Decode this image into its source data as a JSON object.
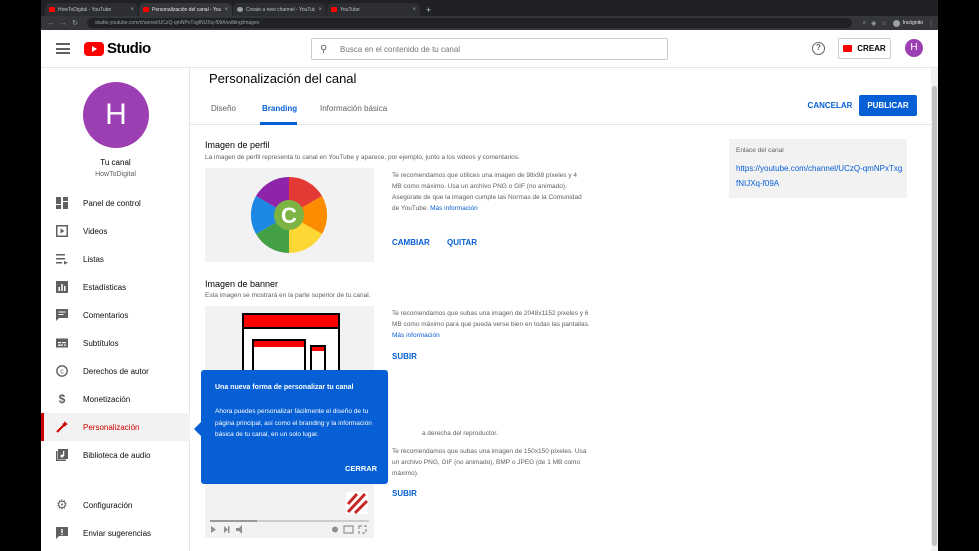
{
  "browser": {
    "tabs": [
      {
        "label": "HowToDigital - YouTube"
      },
      {
        "label": "Personalización del canal - YouTube Studio"
      },
      {
        "label": "Create a new channel - YouTube"
      },
      {
        "label": "YouTube"
      }
    ],
    "new_tab": "+",
    "url": "studio.youtube.com/channel/UCzQ-qmNPxTxgfNIJXq-f09A/editing/images",
    "profile": "Incógnito"
  },
  "header": {
    "logo_text": "Studio",
    "search_placeholder": "Busca en el contenido de tu canal",
    "help": "?",
    "create_label": "CREAR",
    "avatar_letter": "H"
  },
  "sidebar": {
    "avatar_letter": "H",
    "channel_label": "Tu canal",
    "channel_name": "HowToDigital",
    "items": [
      {
        "label": "Panel de control",
        "icon": "dashboard-icon"
      },
      {
        "label": "Videos",
        "icon": "videos-icon"
      },
      {
        "label": "Listas",
        "icon": "playlists-icon"
      },
      {
        "label": "Estadísticas",
        "icon": "analytics-icon"
      },
      {
        "label": "Comentarios",
        "icon": "comments-icon"
      },
      {
        "label": "Subtítulos",
        "icon": "subtitles-icon"
      },
      {
        "label": "Derechos de autor",
        "icon": "copyright-icon"
      },
      {
        "label": "Monetización",
        "icon": "monetization-icon"
      },
      {
        "label": "Personalización",
        "icon": "customization-icon"
      },
      {
        "label": "Biblioteca de audio",
        "icon": "audio-library-icon"
      }
    ],
    "bottom_items": [
      {
        "label": "Configuración",
        "icon": "settings-icon"
      },
      {
        "label": "Enviar sugerencias",
        "icon": "feedback-icon"
      }
    ]
  },
  "main": {
    "title": "Personalización del canal",
    "tabs": [
      {
        "label": "Diseño"
      },
      {
        "label": "Branding"
      },
      {
        "label": "Información básica"
      }
    ],
    "cancel_label": "CANCELAR",
    "publish_label": "PUBLICAR",
    "profile_section": {
      "title": "Imagen de perfil",
      "description": "La imagen de perfil representa tu canal en YouTube y aparece, por ejemplo, junto a los videos y comentarios.",
      "recommendation": "Te recomendamos que utilices una imagen de 98x98 píxeles y 4 MB como máximo. Usa un archivo PNG o GIF (no animado). Asegúrate de que la imagen cumple las Normas de la Comunidad de YouTube.",
      "more_info": "Más información",
      "change_label": "CAMBIAR",
      "remove_label": "QUITAR"
    },
    "banner_section": {
      "title": "Imagen de banner",
      "description": "Esta imagen se mostrará en la parte superior de tu canal.",
      "recommendation": "Te recomendamos que subas una imagen de 2048x1152 píxeles y 6 MB como máximo para que pueda verse bien en todas las pantallas.",
      "more_info": "Más información",
      "upload_label": "SUBIR"
    },
    "watermark_section": {
      "description_tail": "a derecha del reproductor.",
      "recommendation": "Te recomendamos que subas una imagen de 150x150 píxeles. Usa un archivo PNG, GIF (no animado), BMP o JPEG (de 1 MB como máximo).",
      "upload_label": "SUBIR"
    },
    "link_card": {
      "label": "Enlace del canal",
      "url": "https://youtube.com/channel/UCzQ-qmNPxTxgfNIJXq-f09A"
    }
  },
  "tooltip": {
    "title": "Una nueva forma de personalizar tu canal",
    "body": "Ahora puedes personalizar fácilmente el diseño de tu página principal, así como el branding y la información básica de tu canal, en un solo lugar.",
    "close_label": "CERRAR"
  },
  "colors": {
    "accent": "#065fd4",
    "brand_red": "#ff0000",
    "avatar": "#9c3fb3",
    "active_nav": "#cc0000"
  }
}
